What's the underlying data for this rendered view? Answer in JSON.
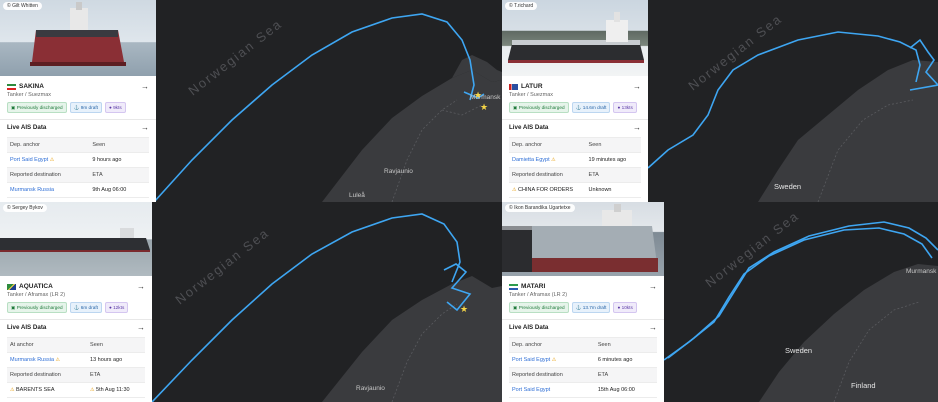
{
  "panels": [
    {
      "credit": "© Gilt Whitten",
      "vessel_name": "SAKINA",
      "vessel_type": "Tanker / Suezmax",
      "badges": [
        "Previously discharged",
        "9m draft",
        "9kts"
      ],
      "ais_title": "Live AIS Data",
      "header_row": [
        "Dep. anchor",
        "Seen"
      ],
      "port_row": [
        "Port Said Egypt",
        "9 hours ago"
      ],
      "dest_header": [
        "Reported destination",
        "ETA"
      ],
      "dest_row": [
        "Murmansk Russia",
        "9th Aug 06:00"
      ],
      "map_labels": [
        "Norwegian Sea",
        "Murmansk",
        "Ravjaunio",
        "Luleå"
      ]
    },
    {
      "credit": "© T.richard",
      "vessel_name": "LATUR",
      "vessel_type": "Tanker / Suezmax",
      "badges": [
        "Previously discharged",
        "14.6m draft",
        "13kts"
      ],
      "ais_title": "Live AIS Data",
      "header_row": [
        "Dep. anchor",
        "Seen"
      ],
      "port_row": [
        "Damietta Egypt",
        "19 minutes ago"
      ],
      "dest_header": [
        "Reported destination",
        "ETA"
      ],
      "dest_row": [
        "CHINA FOR ORDERS",
        "Unknown"
      ],
      "map_labels": [
        "Norwegian Sea",
        "Sweden"
      ]
    },
    {
      "credit": "© Sergey Bykov",
      "vessel_name": "AQUATICA",
      "vessel_type": "Tanker / Aframax (LR 2)",
      "badges": [
        "Previously discharged",
        "6m draft",
        "12kts"
      ],
      "ais_title": "Live AIS Data",
      "header_row": [
        "At anchor",
        "Seen"
      ],
      "port_row": [
        "Murmansk Russia",
        "13 hours ago"
      ],
      "dest_header": [
        "Reported destination",
        "ETA"
      ],
      "dest_row": [
        "BARENTS SEA",
        "5th Aug 11:30"
      ],
      "map_labels": [
        "Norwegian Sea",
        "Ravjaunio"
      ]
    },
    {
      "credit": "© Ikon Barandika Ugartetxe",
      "vessel_name": "MATARI",
      "vessel_type": "Tanker / Aframax (LR 2)",
      "badges": [
        "Previously discharged",
        "13.7m draft",
        "10kts"
      ],
      "ais_title": "Live AIS Data",
      "header_row": [
        "Dep. anchor",
        "Seen"
      ],
      "port_row": [
        "Port Said Egypt",
        "6 minutes ago"
      ],
      "dest_header": [
        "Reported destination",
        "ETA"
      ],
      "dest_row": [
        "Port Said Egypt",
        "15th Aug 06:00"
      ],
      "map_labels": [
        "Norwegian Sea",
        "Sweden",
        "Finland",
        "Murmansk"
      ]
    }
  ],
  "icons": {
    "open": "→",
    "warning": "⚠",
    "draft": "anchor-icon",
    "speed": "speed-icon",
    "cargo": "cargo-icon"
  },
  "colors": {
    "route": "#3ea6f2",
    "map_bg": "#212224",
    "land": "#3a3b3e",
    "link": "#2f6fd6",
    "warning": "#e8a317"
  }
}
